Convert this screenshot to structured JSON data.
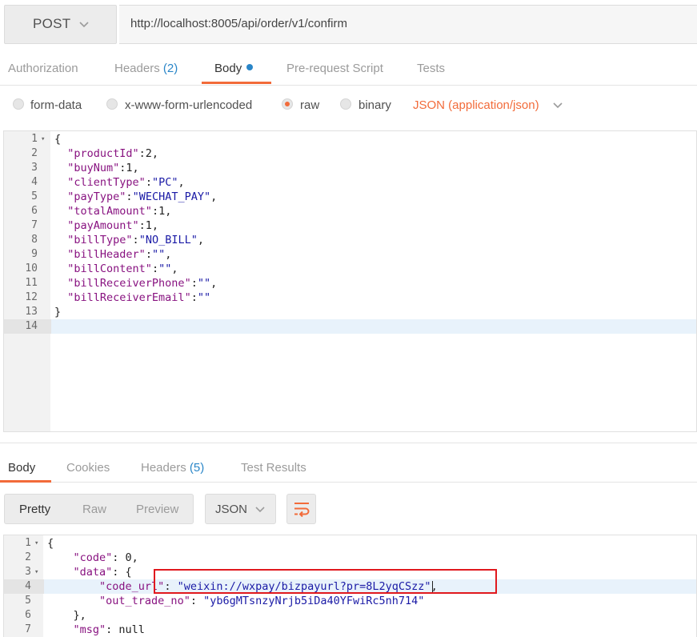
{
  "request": {
    "method": "POST",
    "url": "http://localhost:8005/api/order/v1/confirm"
  },
  "request_tabs": {
    "authorization": "Authorization",
    "headers": "Headers",
    "headers_count": "(2)",
    "body": "Body",
    "prerequest": "Pre-request Script",
    "tests": "Tests"
  },
  "body_types": {
    "form_data": "form-data",
    "urlencoded": "x-www-form-urlencoded",
    "raw": "raw",
    "binary": "binary",
    "selected": "raw",
    "content_type": "JSON (application/json)"
  },
  "request_body_lines": [
    "{",
    "  \"productId\":2,",
    "  \"buyNum\":1,",
    "  \"clientType\":\"PC\",",
    "  \"payType\":\"WECHAT_PAY\",",
    "  \"totalAmount\":1,",
    "  \"payAmount\":1,",
    "  \"billType\":\"NO_BILL\",",
    "  \"billHeader\":\"\",",
    "  \"billContent\":\"\",",
    "  \"billReceiverPhone\":\"\",",
    "  \"billReceiverEmail\":\"\"",
    "}",
    ""
  ],
  "response_tabs": {
    "body": "Body",
    "cookies": "Cookies",
    "headers": "Headers",
    "headers_count": "(5)",
    "test_results": "Test Results"
  },
  "response_toolbar": {
    "pretty": "Pretty",
    "raw": "Raw",
    "preview": "Preview",
    "format": "JSON"
  },
  "response_body_lines": [
    "{",
    "    \"code\": 0,",
    "    \"data\": {",
    "        \"code_url\": \"weixin://wxpay/bizpayurl?pr=8L2yqCSzz\",",
    "        \"out_trade_no\": \"yb6gMTsnzyNrjb5iDa40YFwiRc5nh714\"",
    "    },",
    "    \"msg\": null"
  ],
  "colors": {
    "accent": "#f26b3a",
    "count_blue": "#2a86c8",
    "highlight_box": "#e0191e"
  }
}
